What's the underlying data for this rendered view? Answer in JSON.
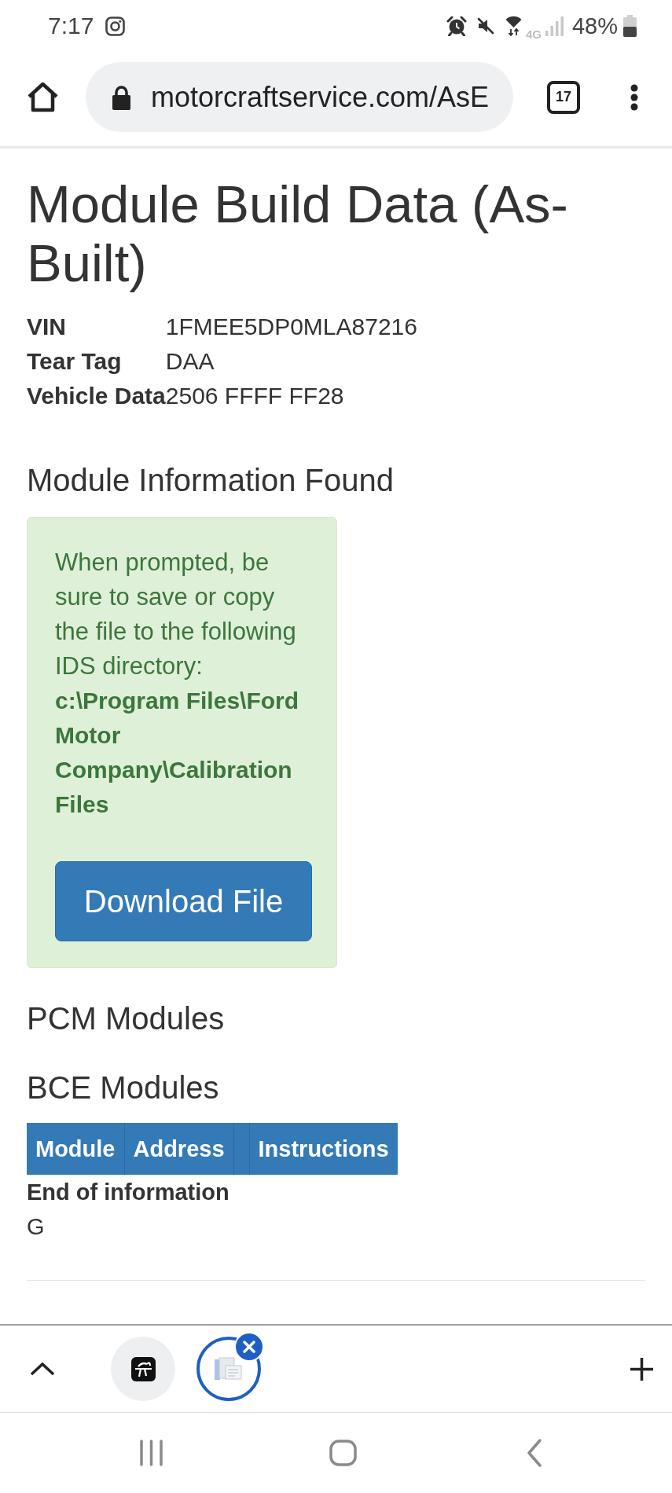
{
  "status_bar": {
    "time": "7:17",
    "network": "4G",
    "battery": "48%"
  },
  "toolbar": {
    "url": "motorcraftservice.com/AsE",
    "tab_count": "17"
  },
  "page": {
    "title": "Module Build Data (As-Built)",
    "details": [
      {
        "label": "VIN",
        "value": "1FMEE5DP0MLA87216"
      },
      {
        "label": "Tear Tag",
        "value": "DAA"
      },
      {
        "label": "Vehicle Data",
        "value": "2506 FFFF FF28"
      }
    ],
    "module_info": {
      "heading": "Module Information Found",
      "alert": {
        "message": "When prompted, be sure to save or copy the file to the following IDS directory:",
        "path": "c:\\Program Files\\Ford Motor Company\\Calibration Files",
        "button": "Download File"
      }
    },
    "pcm": {
      "heading": "PCM Modules"
    },
    "bce": {
      "heading": "BCE Modules",
      "table": {
        "columns": [
          {
            "kind": "label",
            "label": "Module"
          },
          {
            "kind": "label",
            "label": "Address"
          },
          {
            "kind": "blank"
          },
          {
            "kind": "label",
            "label": "Instructions"
          }
        ]
      }
    },
    "end_note": "End of information",
    "trailing_text": "G"
  },
  "tab_strip": {
    "tabs": [
      {
        "kind": "logo",
        "selected": false
      },
      {
        "kind": "document",
        "selected": true
      }
    ]
  }
}
